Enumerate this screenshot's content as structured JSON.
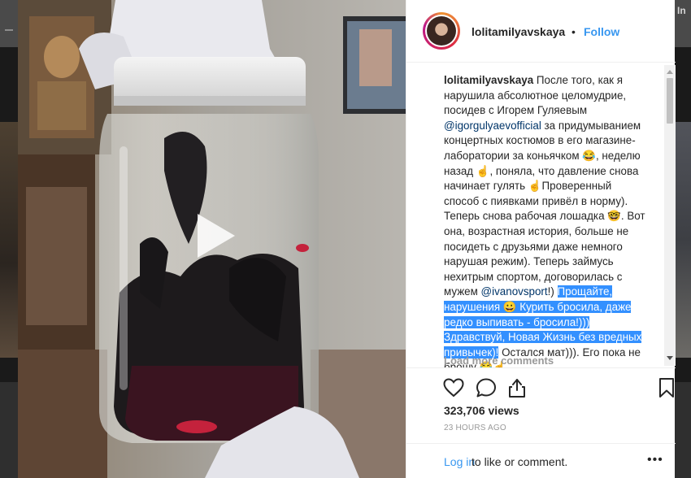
{
  "backdrop": {
    "corner_text": "In"
  },
  "post": {
    "username": "lolitamilyavskaya",
    "separator": "•",
    "follow_label": "Follow",
    "caption": {
      "user": "lolitamilyavskaya",
      "t1": " После того, как я нарушила абсолютное целомудрие, посидев с Игорем Гуляевым ",
      "mention1": "@igorgulyaevofficial",
      "t2": " за придумыванием концертных костюмов в его магазине-лаборатории за коньячком 😂, неделю назад ☝, поняла, что давление снова начинает гулять ☝Проверенный способ с пиявками привёл в норму). Теперь снова рабочая лошадка 🤓. Вот она, возрастная история, больше не посидеть с друзьями даже немного нарушая режим). Теперь займусь нехитрым спортом, договорилась с мужем ",
      "mention2": "@ivanovsport",
      "t3": "!) ",
      "selected": "Прощайте, нарушения 😀 Курить бросила, даже редко выпивать - бросила!))) Здравствуй, Новая Жизнь без вредных привычек)!",
      "t4": " Остался мат))). Его пока не брошу 😂☝"
    },
    "load_more": "Load more comments",
    "views": "323,706 views",
    "time": "23 HOURS AGO",
    "login_link": "Log in",
    "login_rest": " to like or comment.",
    "more": "•••",
    "icons": {
      "like": "heart-icon",
      "comment": "comment-icon",
      "share": "share-icon",
      "save": "bookmark-icon",
      "play": "play-icon"
    }
  },
  "colors": {
    "link": "#3897f0",
    "mention": "#003569",
    "selection": "#3390ff"
  }
}
